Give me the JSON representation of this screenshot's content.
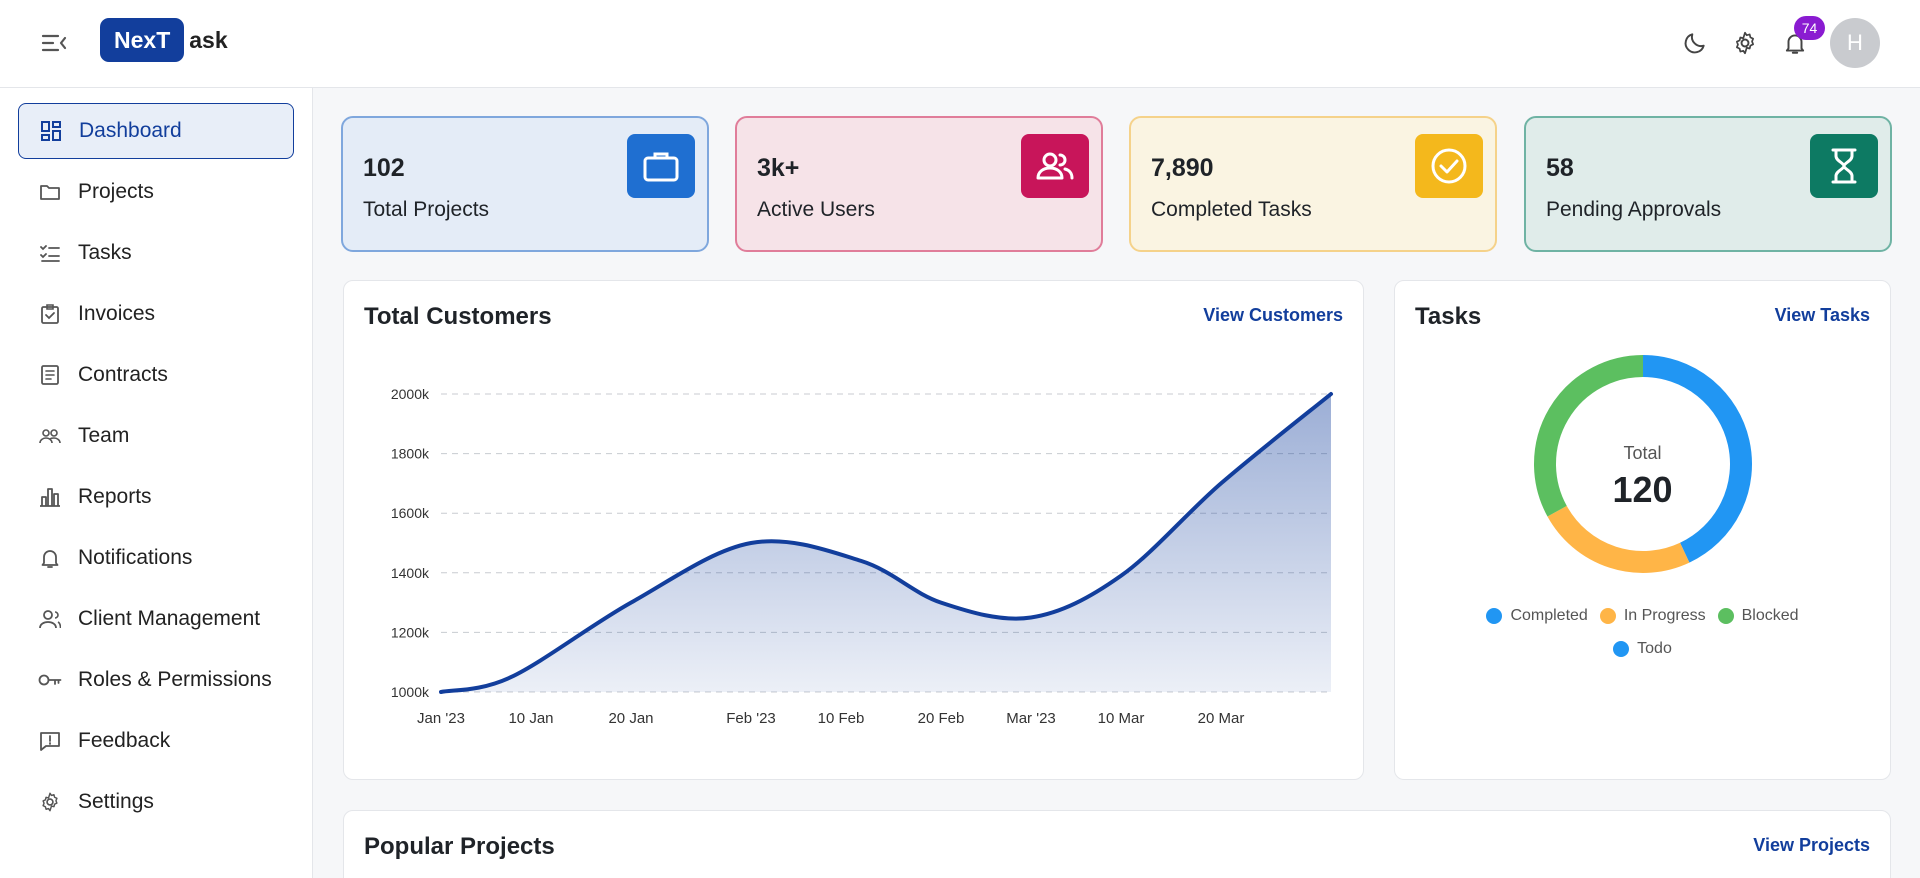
{
  "header": {
    "logo_box": "NexT",
    "logo_rest": "ask",
    "notification_count": "74",
    "avatar_initial": "H"
  },
  "sidebar": {
    "items": [
      {
        "label": "Dashboard",
        "icon": "dashboard-icon"
      },
      {
        "label": "Projects",
        "icon": "folder-icon"
      },
      {
        "label": "Tasks",
        "icon": "checklist-icon"
      },
      {
        "label": "Invoices",
        "icon": "clipboard-check-icon"
      },
      {
        "label": "Contracts",
        "icon": "document-icon"
      },
      {
        "label": "Team",
        "icon": "team-icon"
      },
      {
        "label": "Reports",
        "icon": "bar-chart-icon"
      },
      {
        "label": "Notifications",
        "icon": "bell-icon"
      },
      {
        "label": "Client Management",
        "icon": "client-icon"
      },
      {
        "label": "Roles & Permissions",
        "icon": "key-icon"
      },
      {
        "label": "Feedback",
        "icon": "feedback-icon"
      },
      {
        "label": "Settings",
        "icon": "gear-icon"
      }
    ]
  },
  "stats": [
    {
      "value": "102",
      "label": "Total Projects",
      "icon": "briefcase-icon",
      "bg": "#e4ecf7",
      "border": "#7fa7dd",
      "icon_bg": "#1f6fd1"
    },
    {
      "value": "3k+",
      "label": "Active Users",
      "icon": "users-icon",
      "bg": "#f6e3e8",
      "border": "#e07d9a",
      "icon_bg": "#c8155a"
    },
    {
      "value": "7,890",
      "label": "Completed Tasks",
      "icon": "check-circle-icon",
      "bg": "#faf4e2",
      "border": "#f5d28a",
      "icon_bg": "#f4b81c"
    },
    {
      "value": "58",
      "label": "Pending Approvals",
      "icon": "hourglass-icon",
      "bg": "#e0ecea",
      "border": "#6fb3a4",
      "icon_bg": "#0d7a63"
    }
  ],
  "customers_panel": {
    "title": "Total Customers",
    "link": "View Customers"
  },
  "tasks_panel": {
    "title": "Tasks",
    "link": "View Tasks",
    "total_label": "Total",
    "total_value": "120",
    "legend": [
      {
        "label": "Completed",
        "color": "#2196f3"
      },
      {
        "label": "In Progress",
        "color": "#ffb547"
      },
      {
        "label": "Blocked",
        "color": "#5cbf60"
      },
      {
        "label": "Todo",
        "color": "#2196f3"
      }
    ]
  },
  "projects_panel": {
    "title": "Popular Projects",
    "link": "View Projects"
  },
  "chart_data": [
    {
      "type": "area",
      "title": "",
      "xlabel": "",
      "ylabel": "",
      "x_tick_labels": [
        "Jan '23",
        "10 Jan",
        "20 Jan",
        "Feb '23",
        "10 Feb",
        "20 Feb",
        "Mar '23",
        "10 Mar",
        "20 Mar"
      ],
      "y_tick_labels": [
        "1000k",
        "1200k",
        "1400k",
        "1600k",
        "1800k",
        "2000k"
      ],
      "ylim": [
        1000,
        2000
      ],
      "x": [
        "2023-01-01",
        "2023-01-08",
        "2023-01-20",
        "2023-02-01",
        "2023-02-12",
        "2023-02-20",
        "2023-03-01",
        "2023-03-10",
        "2023-03-20",
        "2023-03-31"
      ],
      "values": [
        1000,
        1050,
        1300,
        1500,
        1440,
        1300,
        1250,
        1390,
        1700,
        2000
      ],
      "grid": true,
      "color": "#123e9c"
    },
    {
      "type": "pie",
      "title": "",
      "categories": [
        "Completed",
        "In Progress",
        "Blocked"
      ],
      "values": [
        43,
        24,
        33
      ],
      "colors": [
        "#2196f3",
        "#ffb547",
        "#5cbf60"
      ]
    }
  ]
}
